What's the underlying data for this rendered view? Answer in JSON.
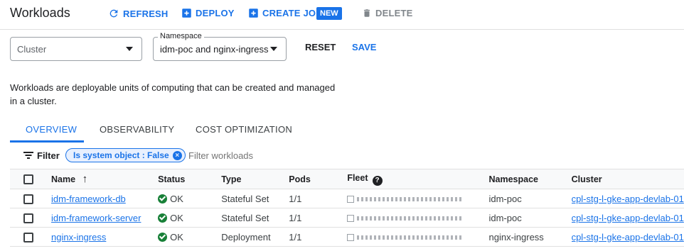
{
  "header": {
    "title": "Workloads",
    "refresh_label": "REFRESH",
    "deploy_label": "DEPLOY",
    "create_job_label": "CREATE JOB",
    "new_badge": "NEW",
    "delete_label": "DELETE"
  },
  "filters": {
    "cluster_placeholder": "Cluster",
    "namespace_label": "Namespace",
    "namespace_value": "idm-poc and nginx-ingress",
    "reset_label": "RESET",
    "save_label": "SAVE"
  },
  "description": "Workloads are deployable units of computing that can be created and managed in a cluster.",
  "tabs": [
    {
      "label": "OVERVIEW",
      "active": true
    },
    {
      "label": "OBSERVABILITY",
      "active": false
    },
    {
      "label": "COST OPTIMIZATION",
      "active": false
    }
  ],
  "filter_bar": {
    "label": "Filter",
    "chip": "Is system object : False",
    "placeholder": "Filter workloads"
  },
  "table": {
    "columns": [
      "Name",
      "Status",
      "Type",
      "Pods",
      "Fleet",
      "Namespace",
      "Cluster"
    ],
    "rows": [
      {
        "name": "idm-framework-db",
        "status": "OK",
        "type": "Stateful Set",
        "pods": "1/1",
        "namespace": "idm-poc",
        "cluster": "cpl-stg-l-gke-app-devlab-01"
      },
      {
        "name": "idm-framework-server",
        "status": "OK",
        "type": "Stateful Set",
        "pods": "1/1",
        "namespace": "idm-poc",
        "cluster": "cpl-stg-l-gke-app-devlab-01"
      },
      {
        "name": "nginx-ingress",
        "status": "OK",
        "type": "Deployment",
        "pods": "1/1",
        "namespace": "nginx-ingress",
        "cluster": "cpl-stg-l-gke-app-devlab-01"
      }
    ]
  },
  "colors": {
    "accent": "#1a73e8",
    "ok": "#188038"
  }
}
